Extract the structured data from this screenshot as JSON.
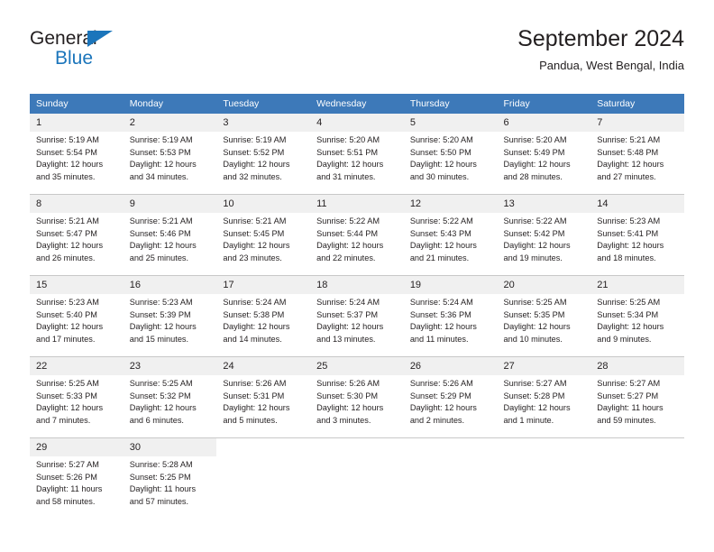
{
  "brand": {
    "name_top": "General",
    "name_bottom": "Blue",
    "triangle_color": "#1b75bb",
    "text_color": "#231f20"
  },
  "header": {
    "title": "September 2024",
    "subtitle": "Pandua, West Bengal, India"
  },
  "colors": {
    "header_row_bg": "#3d79b9",
    "header_row_text": "#ffffff",
    "daynum_bg": "#f0f0f0",
    "cell_separator": "#c8c8c8",
    "body_text": "#231f20"
  },
  "weekday_headers": [
    "Sunday",
    "Monday",
    "Tuesday",
    "Wednesday",
    "Thursday",
    "Friday",
    "Saturday"
  ],
  "labels": {
    "sunrise_prefix": "Sunrise:",
    "sunset_prefix": "Sunset:",
    "daylight_prefix": "Daylight:"
  },
  "weeks": [
    [
      {
        "day": "1",
        "sunrise": "Sunrise: 5:19 AM",
        "sunset": "Sunset: 5:54 PM",
        "daylight_line1": "Daylight: 12 hours",
        "daylight_line2": "and 35 minutes."
      },
      {
        "day": "2",
        "sunrise": "Sunrise: 5:19 AM",
        "sunset": "Sunset: 5:53 PM",
        "daylight_line1": "Daylight: 12 hours",
        "daylight_line2": "and 34 minutes."
      },
      {
        "day": "3",
        "sunrise": "Sunrise: 5:19 AM",
        "sunset": "Sunset: 5:52 PM",
        "daylight_line1": "Daylight: 12 hours",
        "daylight_line2": "and 32 minutes."
      },
      {
        "day": "4",
        "sunrise": "Sunrise: 5:20 AM",
        "sunset": "Sunset: 5:51 PM",
        "daylight_line1": "Daylight: 12 hours",
        "daylight_line2": "and 31 minutes."
      },
      {
        "day": "5",
        "sunrise": "Sunrise: 5:20 AM",
        "sunset": "Sunset: 5:50 PM",
        "daylight_line1": "Daylight: 12 hours",
        "daylight_line2": "and 30 minutes."
      },
      {
        "day": "6",
        "sunrise": "Sunrise: 5:20 AM",
        "sunset": "Sunset: 5:49 PM",
        "daylight_line1": "Daylight: 12 hours",
        "daylight_line2": "and 28 minutes."
      },
      {
        "day": "7",
        "sunrise": "Sunrise: 5:21 AM",
        "sunset": "Sunset: 5:48 PM",
        "daylight_line1": "Daylight: 12 hours",
        "daylight_line2": "and 27 minutes."
      }
    ],
    [
      {
        "day": "8",
        "sunrise": "Sunrise: 5:21 AM",
        "sunset": "Sunset: 5:47 PM",
        "daylight_line1": "Daylight: 12 hours",
        "daylight_line2": "and 26 minutes."
      },
      {
        "day": "9",
        "sunrise": "Sunrise: 5:21 AM",
        "sunset": "Sunset: 5:46 PM",
        "daylight_line1": "Daylight: 12 hours",
        "daylight_line2": "and 25 minutes."
      },
      {
        "day": "10",
        "sunrise": "Sunrise: 5:21 AM",
        "sunset": "Sunset: 5:45 PM",
        "daylight_line1": "Daylight: 12 hours",
        "daylight_line2": "and 23 minutes."
      },
      {
        "day": "11",
        "sunrise": "Sunrise: 5:22 AM",
        "sunset": "Sunset: 5:44 PM",
        "daylight_line1": "Daylight: 12 hours",
        "daylight_line2": "and 22 minutes."
      },
      {
        "day": "12",
        "sunrise": "Sunrise: 5:22 AM",
        "sunset": "Sunset: 5:43 PM",
        "daylight_line1": "Daylight: 12 hours",
        "daylight_line2": "and 21 minutes."
      },
      {
        "day": "13",
        "sunrise": "Sunrise: 5:22 AM",
        "sunset": "Sunset: 5:42 PM",
        "daylight_line1": "Daylight: 12 hours",
        "daylight_line2": "and 19 minutes."
      },
      {
        "day": "14",
        "sunrise": "Sunrise: 5:23 AM",
        "sunset": "Sunset: 5:41 PM",
        "daylight_line1": "Daylight: 12 hours",
        "daylight_line2": "and 18 minutes."
      }
    ],
    [
      {
        "day": "15",
        "sunrise": "Sunrise: 5:23 AM",
        "sunset": "Sunset: 5:40 PM",
        "daylight_line1": "Daylight: 12 hours",
        "daylight_line2": "and 17 minutes."
      },
      {
        "day": "16",
        "sunrise": "Sunrise: 5:23 AM",
        "sunset": "Sunset: 5:39 PM",
        "daylight_line1": "Daylight: 12 hours",
        "daylight_line2": "and 15 minutes."
      },
      {
        "day": "17",
        "sunrise": "Sunrise: 5:24 AM",
        "sunset": "Sunset: 5:38 PM",
        "daylight_line1": "Daylight: 12 hours",
        "daylight_line2": "and 14 minutes."
      },
      {
        "day": "18",
        "sunrise": "Sunrise: 5:24 AM",
        "sunset": "Sunset: 5:37 PM",
        "daylight_line1": "Daylight: 12 hours",
        "daylight_line2": "and 13 minutes."
      },
      {
        "day": "19",
        "sunrise": "Sunrise: 5:24 AM",
        "sunset": "Sunset: 5:36 PM",
        "daylight_line1": "Daylight: 12 hours",
        "daylight_line2": "and 11 minutes."
      },
      {
        "day": "20",
        "sunrise": "Sunrise: 5:25 AM",
        "sunset": "Sunset: 5:35 PM",
        "daylight_line1": "Daylight: 12 hours",
        "daylight_line2": "and 10 minutes."
      },
      {
        "day": "21",
        "sunrise": "Sunrise: 5:25 AM",
        "sunset": "Sunset: 5:34 PM",
        "daylight_line1": "Daylight: 12 hours",
        "daylight_line2": "and 9 minutes."
      }
    ],
    [
      {
        "day": "22",
        "sunrise": "Sunrise: 5:25 AM",
        "sunset": "Sunset: 5:33 PM",
        "daylight_line1": "Daylight: 12 hours",
        "daylight_line2": "and 7 minutes."
      },
      {
        "day": "23",
        "sunrise": "Sunrise: 5:25 AM",
        "sunset": "Sunset: 5:32 PM",
        "daylight_line1": "Daylight: 12 hours",
        "daylight_line2": "and 6 minutes."
      },
      {
        "day": "24",
        "sunrise": "Sunrise: 5:26 AM",
        "sunset": "Sunset: 5:31 PM",
        "daylight_line1": "Daylight: 12 hours",
        "daylight_line2": "and 5 minutes."
      },
      {
        "day": "25",
        "sunrise": "Sunrise: 5:26 AM",
        "sunset": "Sunset: 5:30 PM",
        "daylight_line1": "Daylight: 12 hours",
        "daylight_line2": "and 3 minutes."
      },
      {
        "day": "26",
        "sunrise": "Sunrise: 5:26 AM",
        "sunset": "Sunset: 5:29 PM",
        "daylight_line1": "Daylight: 12 hours",
        "daylight_line2": "and 2 minutes."
      },
      {
        "day": "27",
        "sunrise": "Sunrise: 5:27 AM",
        "sunset": "Sunset: 5:28 PM",
        "daylight_line1": "Daylight: 12 hours",
        "daylight_line2": "and 1 minute."
      },
      {
        "day": "28",
        "sunrise": "Sunrise: 5:27 AM",
        "sunset": "Sunset: 5:27 PM",
        "daylight_line1": "Daylight: 11 hours",
        "daylight_line2": "and 59 minutes."
      }
    ],
    [
      {
        "day": "29",
        "sunrise": "Sunrise: 5:27 AM",
        "sunset": "Sunset: 5:26 PM",
        "daylight_line1": "Daylight: 11 hours",
        "daylight_line2": "and 58 minutes."
      },
      {
        "day": "30",
        "sunrise": "Sunrise: 5:28 AM",
        "sunset": "Sunset: 5:25 PM",
        "daylight_line1": "Daylight: 11 hours",
        "daylight_line2": "and 57 minutes."
      },
      {
        "day": "",
        "sunrise": "",
        "sunset": "",
        "daylight_line1": "",
        "daylight_line2": ""
      },
      {
        "day": "",
        "sunrise": "",
        "sunset": "",
        "daylight_line1": "",
        "daylight_line2": ""
      },
      {
        "day": "",
        "sunrise": "",
        "sunset": "",
        "daylight_line1": "",
        "daylight_line2": ""
      },
      {
        "day": "",
        "sunrise": "",
        "sunset": "",
        "daylight_line1": "",
        "daylight_line2": ""
      },
      {
        "day": "",
        "sunrise": "",
        "sunset": "",
        "daylight_line1": "",
        "daylight_line2": ""
      }
    ]
  ]
}
